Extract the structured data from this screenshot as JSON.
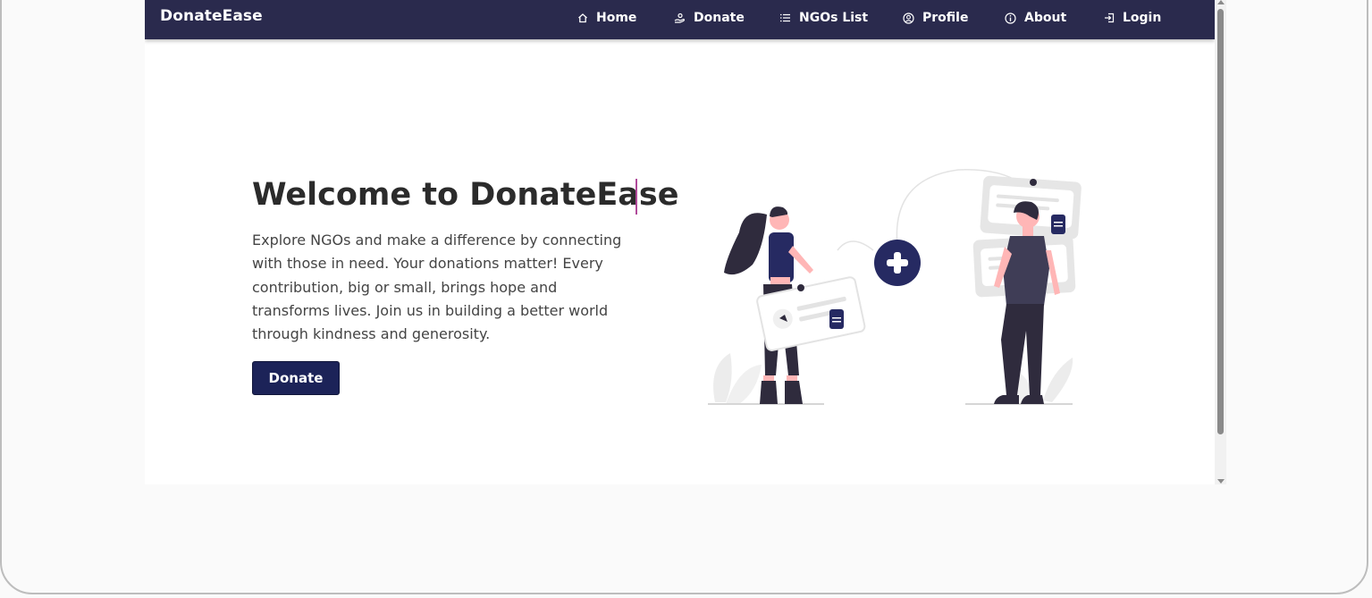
{
  "brand": "DonateEase",
  "nav": {
    "items": [
      {
        "label": "Home",
        "icon": "home-icon"
      },
      {
        "label": "Donate",
        "icon": "hand-donate-icon"
      },
      {
        "label": "NGOs List",
        "icon": "list-icon"
      },
      {
        "label": "Profile",
        "icon": "user-circle-icon"
      },
      {
        "label": "About",
        "icon": "info-icon"
      },
      {
        "label": "Login",
        "icon": "login-icon"
      }
    ]
  },
  "hero": {
    "title": "Welcome to DonateEase",
    "description": "Explore NGOs and make a difference by connecting with those in need. Your donations matter! Every contribution, big or small, brings hope and transforms lives. Join us in building a better world through kindness and generosity.",
    "button_label": "Donate"
  },
  "colors": {
    "navbar": "#2a2a4d",
    "primary_button": "#1c2358",
    "accent": "#b04a9a"
  }
}
